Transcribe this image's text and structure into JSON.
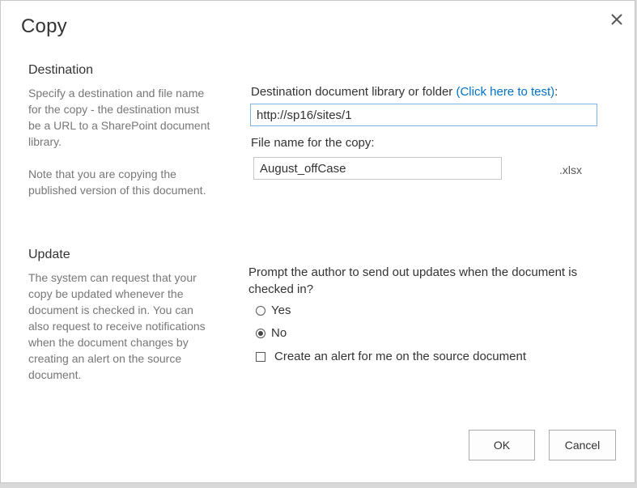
{
  "dialog": {
    "title": "Copy",
    "close_icon": "close-icon"
  },
  "destination": {
    "heading": "Destination",
    "description": "Specify a destination and file name for the copy - the destination must be a URL to a SharePoint document library.",
    "note": "Note that you are copying the published version of this document.",
    "library_label": "Destination document library or folder ",
    "test_link": "(Click here to test)",
    "library_label_suffix": ":",
    "library_value": "http://sp16/sites/1",
    "filename_label": "File name for the copy:",
    "filename_value": "August_offCase",
    "extension": ".xlsx"
  },
  "update": {
    "heading": "Update",
    "description": "The system can request that your copy be updated whenever the document is checked in. You can also request to receive notifications when the document changes by creating an alert on the source document.",
    "question": "Prompt the author to send out updates when the document is checked in?",
    "options": [
      {
        "label": "Yes",
        "selected": false
      },
      {
        "label": "No",
        "selected": true
      }
    ],
    "alert_checkbox_label": "Create an alert for me on the source document",
    "alert_checked": false
  },
  "buttons": {
    "ok": "OK",
    "cancel": "Cancel"
  }
}
